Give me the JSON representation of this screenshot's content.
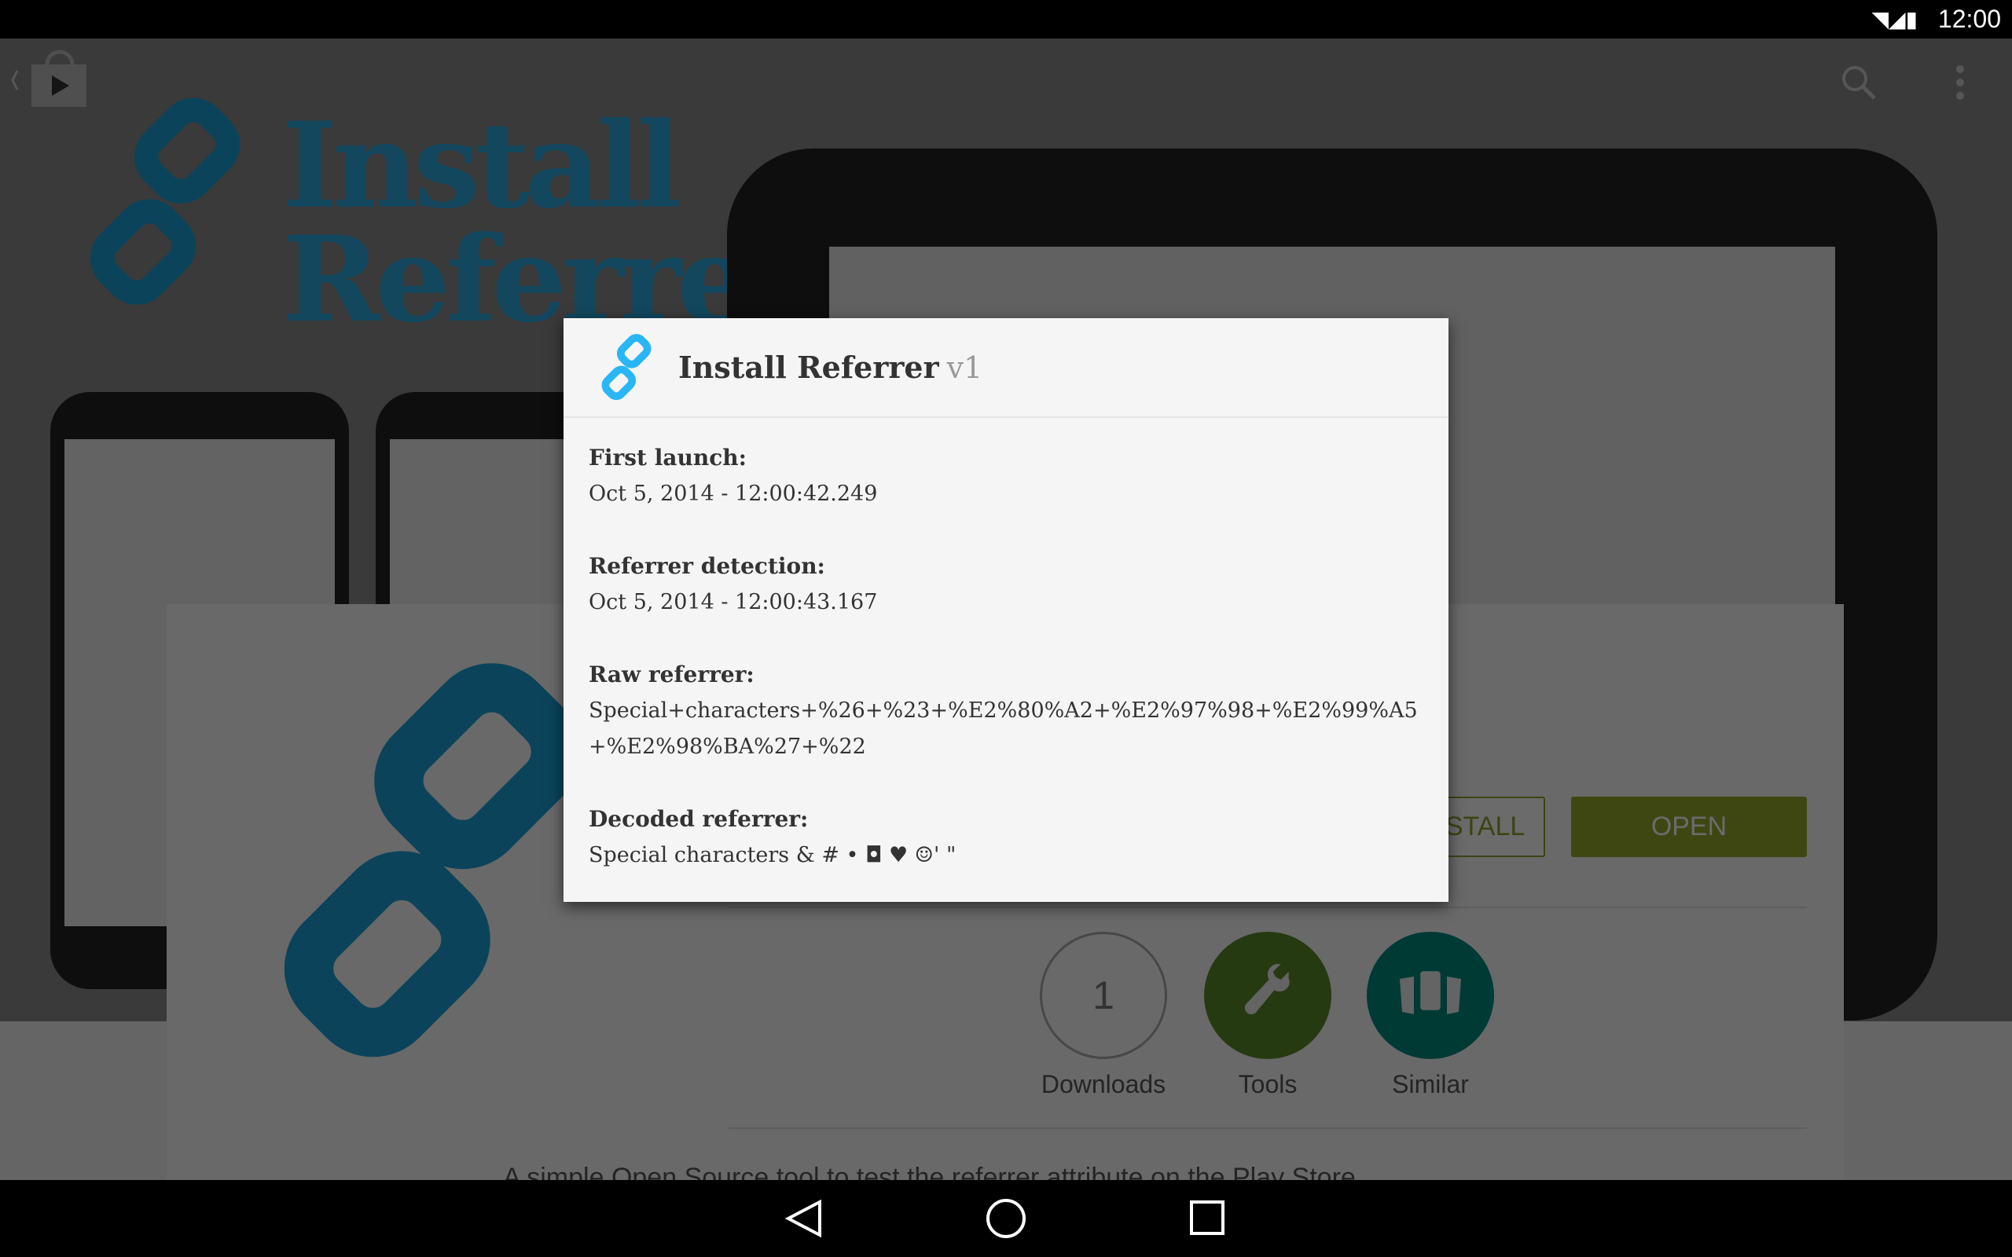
{
  "status_bar": {
    "time": "12:00",
    "icons": [
      "wifi-icon",
      "signal-icon",
      "battery-icon"
    ]
  },
  "background": {
    "banner_title_line1": "Install",
    "banner_title_line2": "Referrer",
    "uninstall_label": "UNINSTALL",
    "open_label": "OPEN",
    "downloads_count": "1",
    "downloads_label": "Downloads",
    "tools_label": "Tools",
    "similar_label": "Similar",
    "description_partial": "A simple Open Source tool to test the referrer attribute on the Play Store",
    "colors": {
      "accent_green": "#93a82c",
      "tools_green": "#5b8a2a",
      "similar_teal": "#00897b",
      "brand_blue": "#1a9fd8"
    }
  },
  "dialog": {
    "title": "Install Referrer",
    "version": "v1",
    "fields": [
      {
        "label": "First launch:",
        "value": "Oct 5, 2014 - 12:00:42.249"
      },
      {
        "label": "Referrer detection:",
        "value": "Oct 5, 2014 - 12:00:43.167"
      },
      {
        "label": "Raw referrer:",
        "value": "Special+characters+%26+%23+%E2%80%A2+%E2%97%98+%E2%99%A5+%E2%98%BA%27+%22"
      },
      {
        "label": "Decoded referrer:",
        "value": "Special characters & # • ◘ ♥ ☺' \""
      }
    ]
  },
  "nav_bar": {
    "buttons": [
      "back",
      "home",
      "recents"
    ]
  }
}
